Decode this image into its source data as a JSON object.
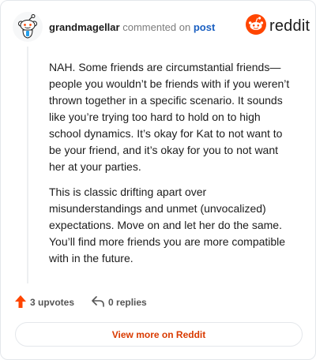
{
  "comment": {
    "author": "grandmagellar",
    "verb": "commented on",
    "target": "post",
    "paragraphs": [
      "NAH. Some friends are circumstantial friends—people you wouldn’t be friends with if you weren’t thrown together in a specific scenario. It sounds like you’re trying too hard to hold on to high school dynamics. It’s okay for Kat to not want to be your friend, and it’s okay for you to not want her at your parties.",
      "This is classic drifting apart over misunderstandings and unmet (unvocalized) expectations. Move on and let her do the same. You’ll find more friends you are more compatible with in the future."
    ]
  },
  "brand": {
    "name": "reddit",
    "accent": "#ff4500"
  },
  "actions": {
    "upvotes_label": "3 upvotes",
    "replies_label": "0 replies",
    "upvote_color": "#ff4500"
  },
  "footer": {
    "view_more_label": "View more on Reddit"
  },
  "icons": {
    "avatar": "snoo-avatar-icon",
    "brand": "reddit-logo-icon",
    "upvote": "upvote-arrow-icon",
    "reply": "reply-arrow-icon"
  }
}
